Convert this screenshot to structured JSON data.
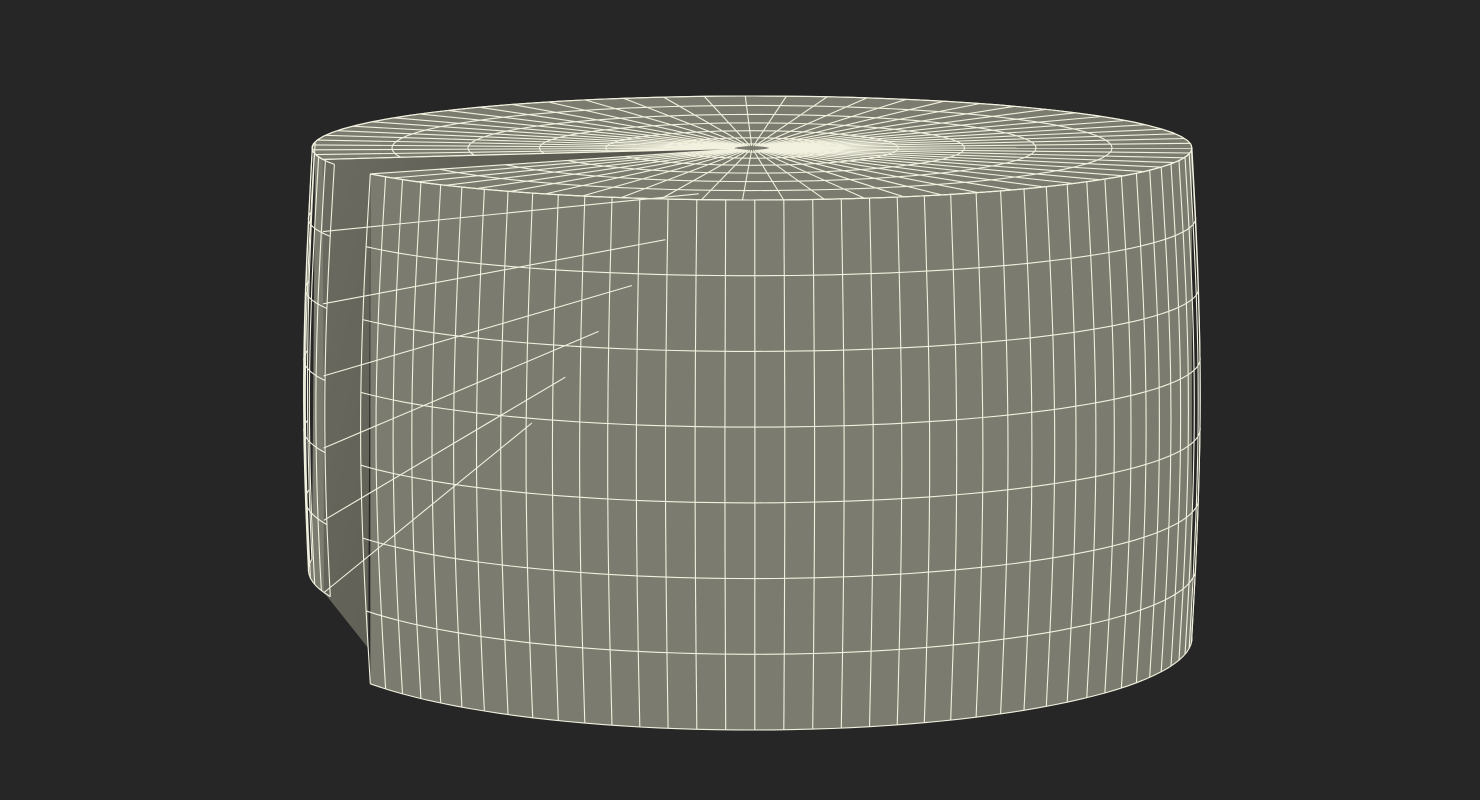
{
  "scene": {
    "subject": "cheese-wheel-wireframe",
    "colors": {
      "background": "#262626",
      "surface": "#7b7c6f",
      "cut_face": "#65655b",
      "cut_face_dark": "#4d4d45",
      "wire": "#f2f1df"
    },
    "mesh": {
      "outer_segments": 40,
      "height_rows": 7,
      "top_rings": 7,
      "cut_gap_fraction": 0.125
    }
  }
}
